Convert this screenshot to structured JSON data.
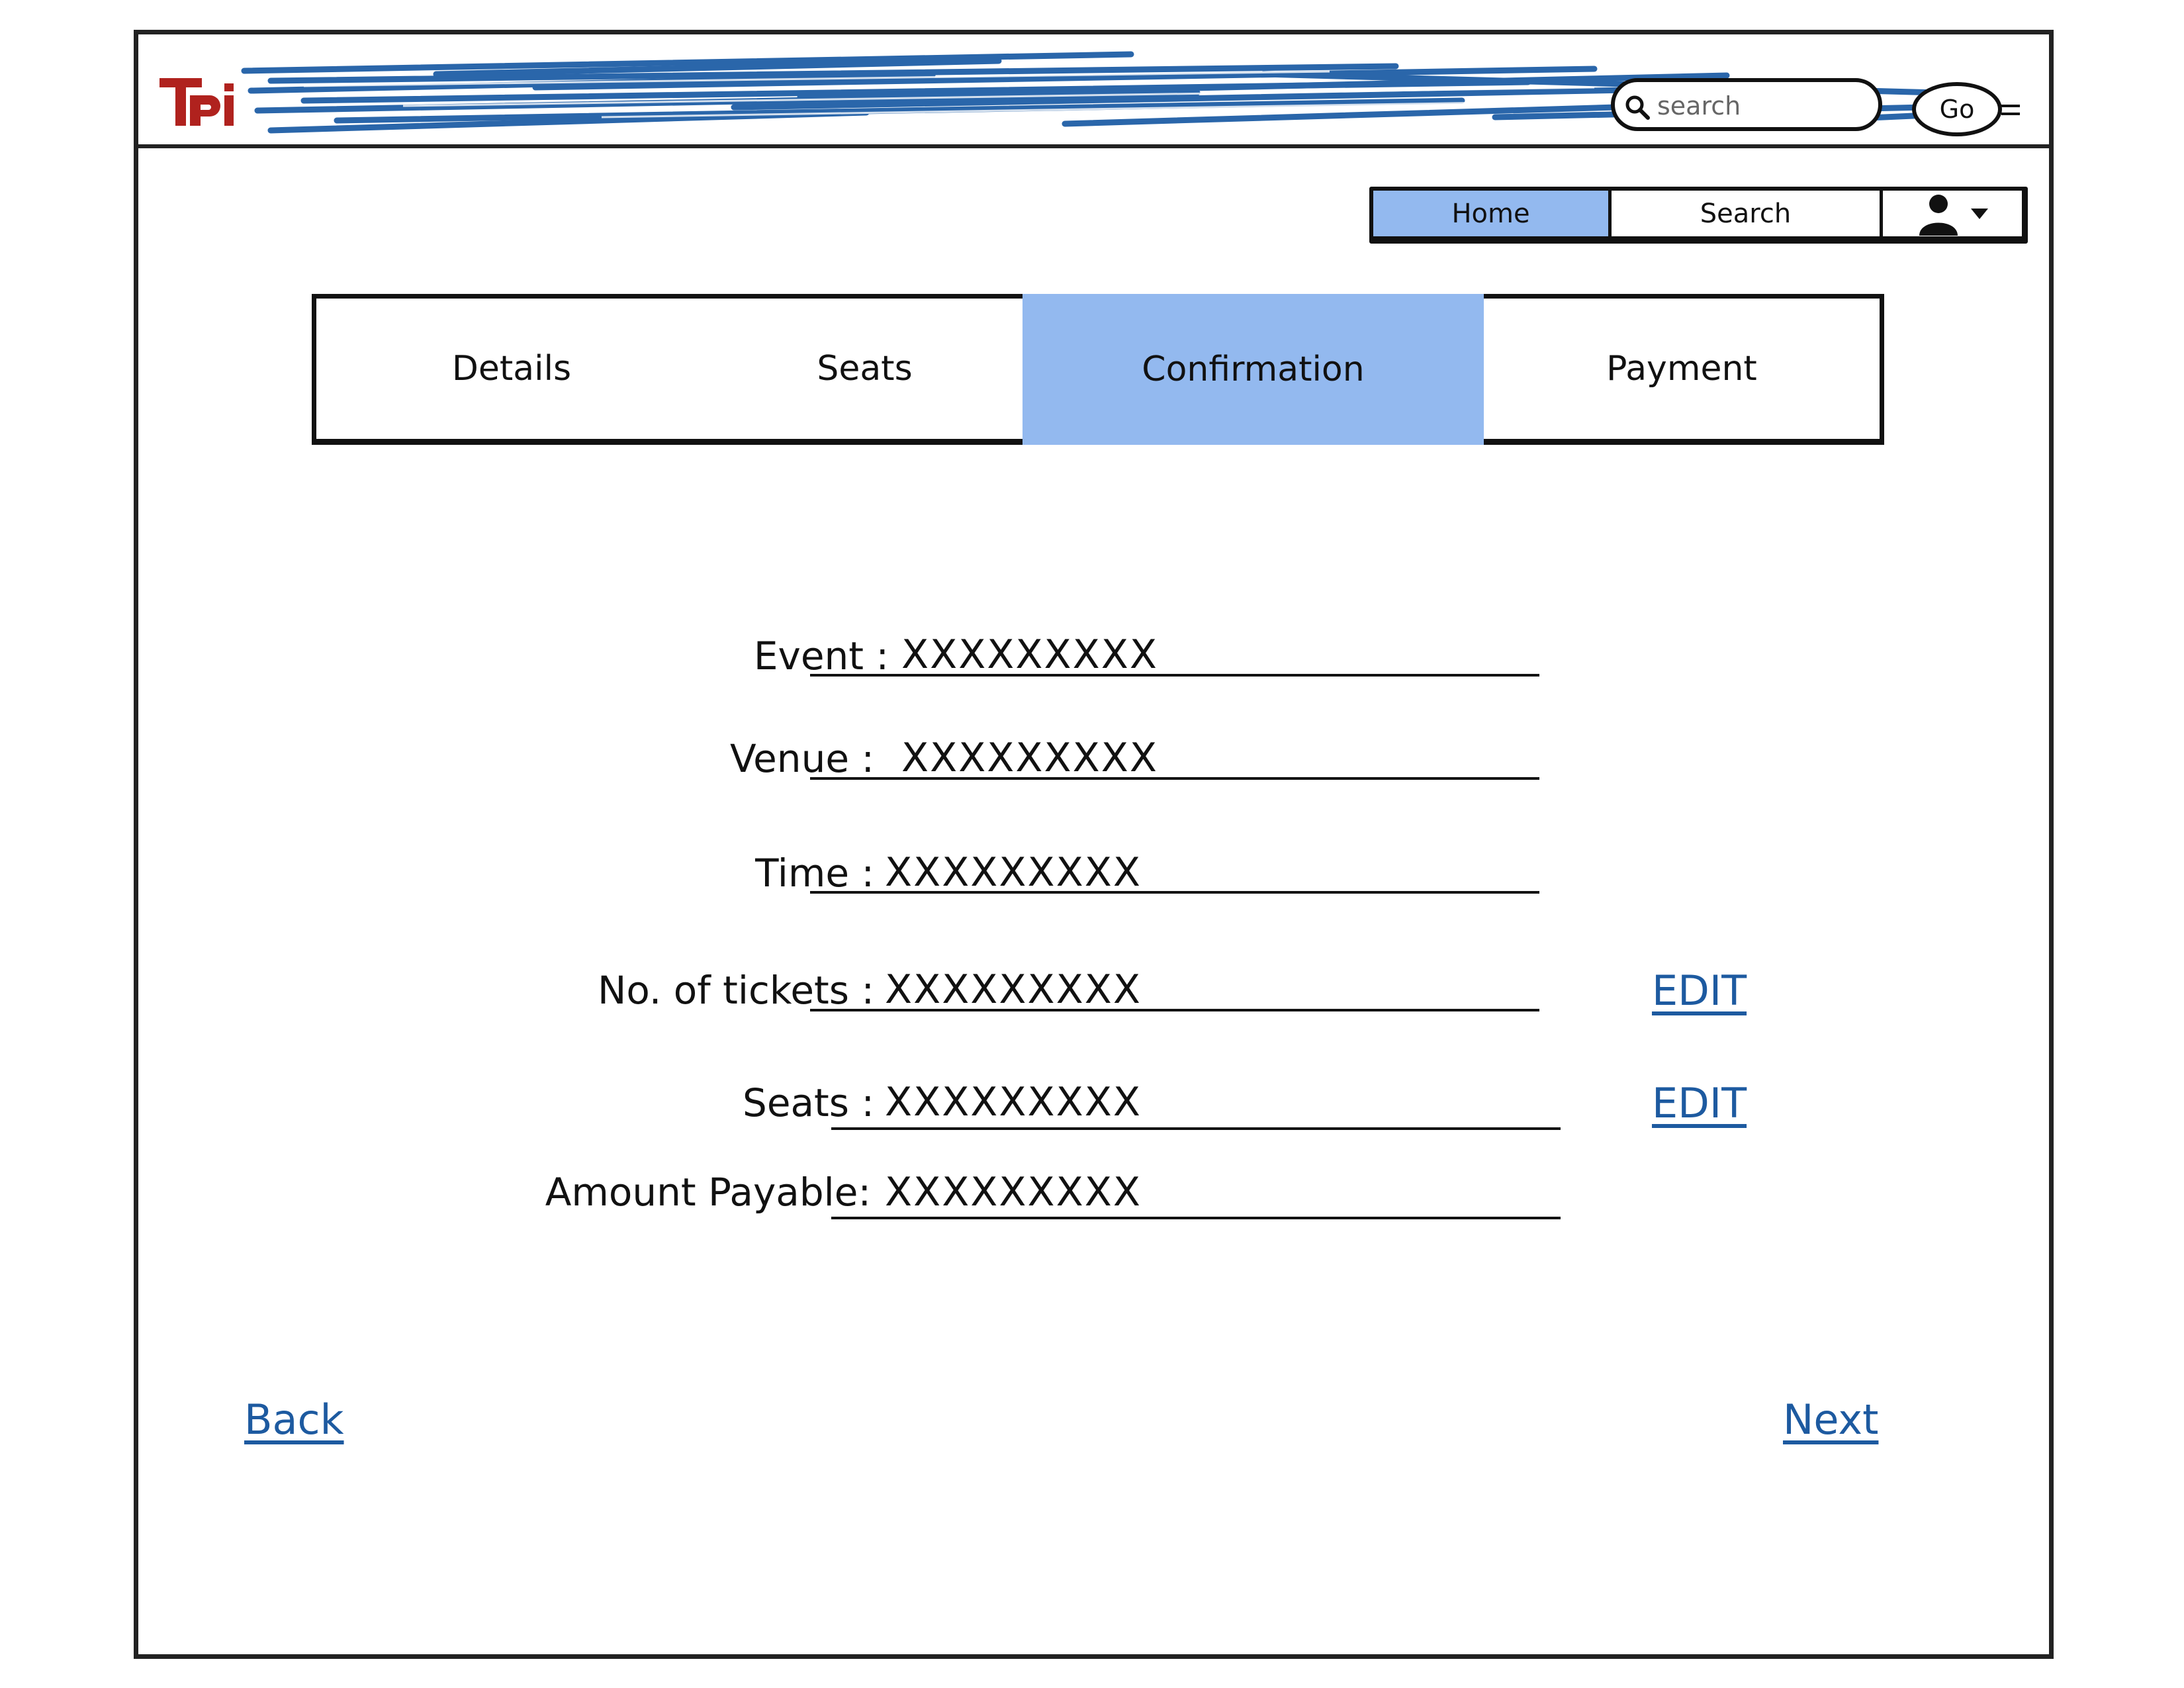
{
  "header": {
    "logo_text": "TPI",
    "search": {
      "placeholder": "search"
    },
    "go_label": "Go"
  },
  "nav": {
    "items": [
      {
        "label": "Home",
        "active": true
      },
      {
        "label": "Search",
        "active": false
      }
    ],
    "user_menu_icon": "user-icon"
  },
  "steps": {
    "tabs": [
      {
        "label": "Details",
        "active": false
      },
      {
        "label": "Seats",
        "active": false
      },
      {
        "label": "Confirmation",
        "active": true
      },
      {
        "label": "Payment",
        "active": false
      }
    ]
  },
  "form": {
    "rows": [
      {
        "label": "Event :",
        "value": "XXXXXXXXX"
      },
      {
        "label": "Venue :",
        "value": "XXXXXXXXX"
      },
      {
        "label": "Time :",
        "value": "XXXXXXXXX"
      },
      {
        "label": "No. of tickets :",
        "value": "XXXXXXXXX",
        "edit": "EDIT"
      },
      {
        "label": "Seats :",
        "value": "XXXXXXXXX",
        "edit": "EDIT"
      },
      {
        "label": "Amount Payable:",
        "value": "XXXXXXXXX"
      }
    ]
  },
  "footer": {
    "back_label": "Back",
    "next_label": "Next"
  },
  "colors": {
    "accent": "#93b9ef",
    "link": "#1d5aa0",
    "brand_red": "#b0221e",
    "scribble_blue": "#1f5ea6"
  }
}
